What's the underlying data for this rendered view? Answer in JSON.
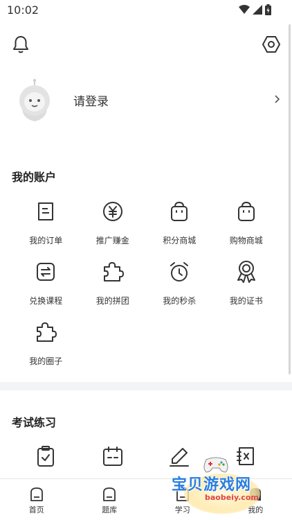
{
  "status_bar": {
    "time": "10:02"
  },
  "profile": {
    "login_label": "请登录"
  },
  "account": {
    "title": "我的账户",
    "items": [
      {
        "label": "我的订单",
        "icon": "order-icon"
      },
      {
        "label": "推广赚金",
        "icon": "yuan-coin-icon"
      },
      {
        "label": "积分商城",
        "icon": "shopping-bag-icon"
      },
      {
        "label": "购物商城",
        "icon": "shopping-bag-icon"
      },
      {
        "label": "兑换课程",
        "icon": "exchange-icon"
      },
      {
        "label": "我的拼团",
        "icon": "puzzle-icon"
      },
      {
        "label": "我的秒杀",
        "icon": "alarm-clock-icon"
      },
      {
        "label": "我的证书",
        "icon": "award-icon"
      },
      {
        "label": "我的圈子",
        "icon": "puzzle-icon"
      }
    ]
  },
  "exam": {
    "title": "考试练习"
  },
  "tabbar": {
    "tabs": [
      {
        "label": "首页"
      },
      {
        "label": "题库"
      },
      {
        "label": "学习"
      },
      {
        "label": "我的"
      }
    ]
  },
  "watermark": {
    "text": "宝贝游戏网",
    "url": "baobeiy.com"
  }
}
